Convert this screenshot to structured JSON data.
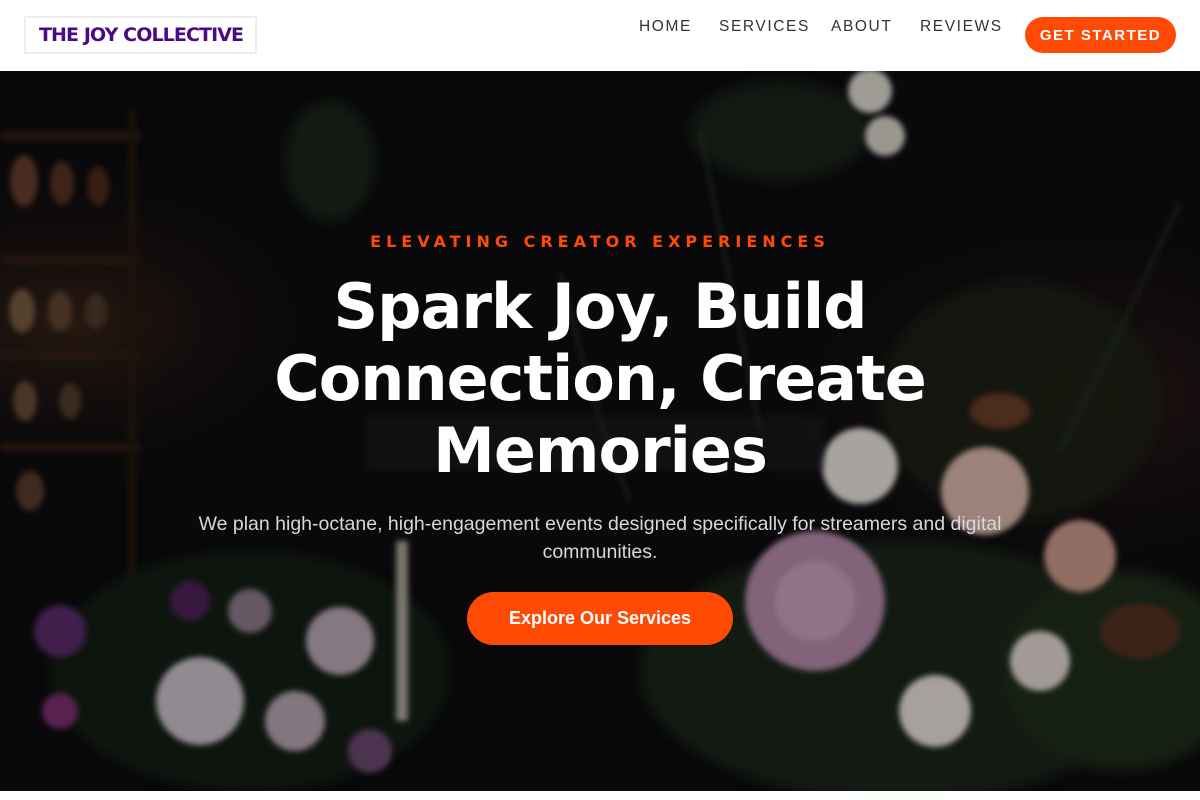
{
  "header": {
    "logo_text": "THE JOY COLLECTIVE",
    "nav": {
      "home": "HOME",
      "services": "SERVICES",
      "about": "ABOUT",
      "reviews": "REVIEWS"
    },
    "cta_label": "GET STARTED"
  },
  "hero": {
    "eyebrow": "ELEVATING CREATOR EXPERIENCES",
    "headline": "Spark Joy, Build Connection, Create Memories",
    "subtitle": "We plan high-octane, high-engagement events designed specifically for streamers and digital communities.",
    "cta_label": "Explore Our Services",
    "background_image": "dark-floral-arrangement-photo"
  },
  "colors": {
    "accent": "#ff4a06",
    "logo": "#4a0a86",
    "nav_text": "#333333",
    "hero_text": "#ffffff"
  }
}
